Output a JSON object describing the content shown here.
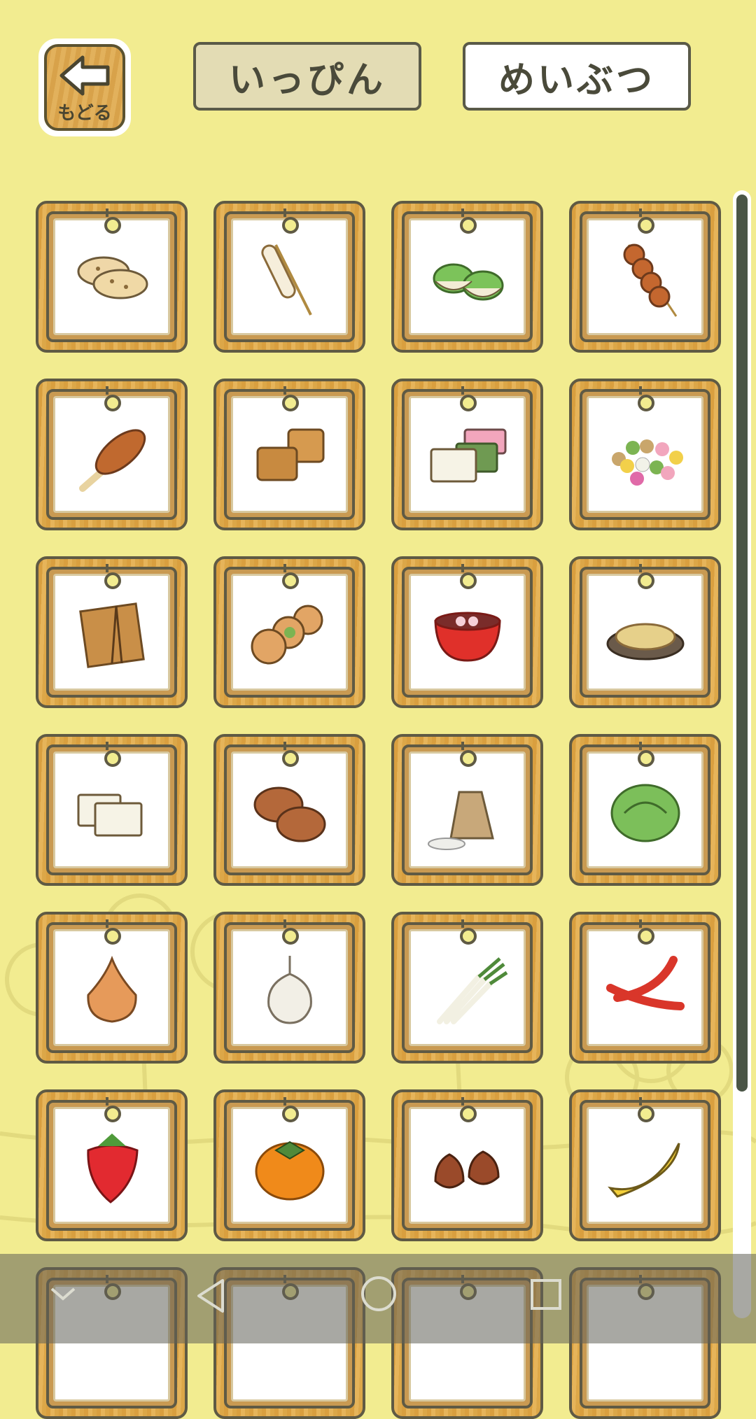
{
  "header": {
    "back_label": "もどる",
    "tabs": [
      {
        "label": "いっぴん",
        "active": true
      },
      {
        "label": "めいぶつ",
        "active": false
      }
    ]
  },
  "items": [
    {
      "icon": "rice-cracker-icon"
    },
    {
      "icon": "kiritanpo-skewer-icon"
    },
    {
      "icon": "green-mochi-icon"
    },
    {
      "icon": "dango-skewer-icon"
    },
    {
      "icon": "gohei-mochi-icon"
    },
    {
      "icon": "caramel-squares-icon"
    },
    {
      "icon": "uiro-sweets-icon"
    },
    {
      "icon": "colorful-candies-icon"
    },
    {
      "icon": "tower-cracker-icon"
    },
    {
      "icon": "round-cookies-icon"
    },
    {
      "icon": "red-soup-bowl-icon"
    },
    {
      "icon": "kinako-mochi-plate-icon"
    },
    {
      "icon": "tofu-blocks-icon"
    },
    {
      "icon": "steamed-buns-icon"
    },
    {
      "icon": "rice-bag-icon"
    },
    {
      "icon": "cabbage-icon"
    },
    {
      "icon": "onion-icon"
    },
    {
      "icon": "garlic-icon"
    },
    {
      "icon": "green-onion-icon"
    },
    {
      "icon": "chili-peppers-icon"
    },
    {
      "icon": "strawberry-icon"
    },
    {
      "icon": "persimmon-icon"
    },
    {
      "icon": "chestnuts-icon"
    },
    {
      "icon": "banana-icon"
    }
  ],
  "colors": {
    "background": "#f2ec90",
    "frame_wood": "#dca748",
    "frame_outline": "#5f5a44",
    "active_tab": "#e3dcb4"
  },
  "navbar": {
    "icons": [
      "collapse-chevron-icon",
      "back-triangle-icon",
      "home-circle-icon",
      "recents-square-icon"
    ]
  }
}
